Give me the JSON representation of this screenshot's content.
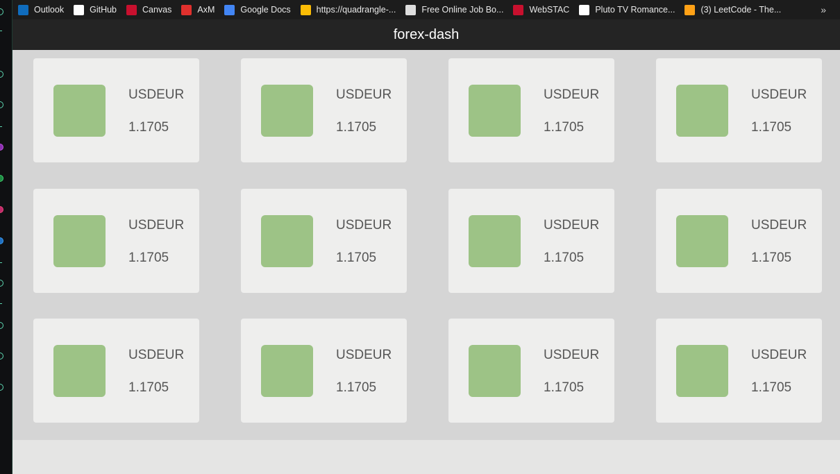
{
  "bookmarks": [
    {
      "label": "Outlook",
      "icon": "outlook-icon",
      "color": "#0f6cbd"
    },
    {
      "label": "GitHub",
      "icon": "github-icon",
      "color": "#ffffff"
    },
    {
      "label": "Canvas",
      "icon": "canvas-icon",
      "color": "#c8102e"
    },
    {
      "label": "AxM",
      "icon": "axm-icon",
      "color": "#e0302d"
    },
    {
      "label": "Google Docs",
      "icon": "google-docs-icon",
      "color": "#4285f4"
    },
    {
      "label": "https://quadrangle-...",
      "icon": "chrome-icon",
      "color": "#fbbc05"
    },
    {
      "label": "Free Online Job Bo...",
      "icon": "target-icon",
      "color": "#dddddd"
    },
    {
      "label": "WebSTAC",
      "icon": "webstac-icon",
      "color": "#c8102e"
    },
    {
      "label": "Pluto TV Romance...",
      "icon": "pluto-icon",
      "color": "#ffffff"
    },
    {
      "label": "(3) LeetCode - The...",
      "icon": "leetcode-icon",
      "color": "#ffa116"
    }
  ],
  "more_label": "»",
  "app": {
    "title": "forex-dash"
  },
  "swatch_color": "#9dc386",
  "cards": [
    {
      "pair": "USDEUR",
      "rate": "1.1705"
    },
    {
      "pair": "USDEUR",
      "rate": "1.1705"
    },
    {
      "pair": "USDEUR",
      "rate": "1.1705"
    },
    {
      "pair": "USDEUR",
      "rate": "1.1705"
    },
    {
      "pair": "USDEUR",
      "rate": "1.1705"
    },
    {
      "pair": "USDEUR",
      "rate": "1.1705"
    },
    {
      "pair": "USDEUR",
      "rate": "1.1705"
    },
    {
      "pair": "USDEUR",
      "rate": "1.1705"
    },
    {
      "pair": "USDEUR",
      "rate": "1.1705"
    },
    {
      "pair": "USDEUR",
      "rate": "1.1705"
    },
    {
      "pair": "USDEUR",
      "rate": "1.1705"
    },
    {
      "pair": "USDEUR",
      "rate": "1.1705"
    }
  ]
}
